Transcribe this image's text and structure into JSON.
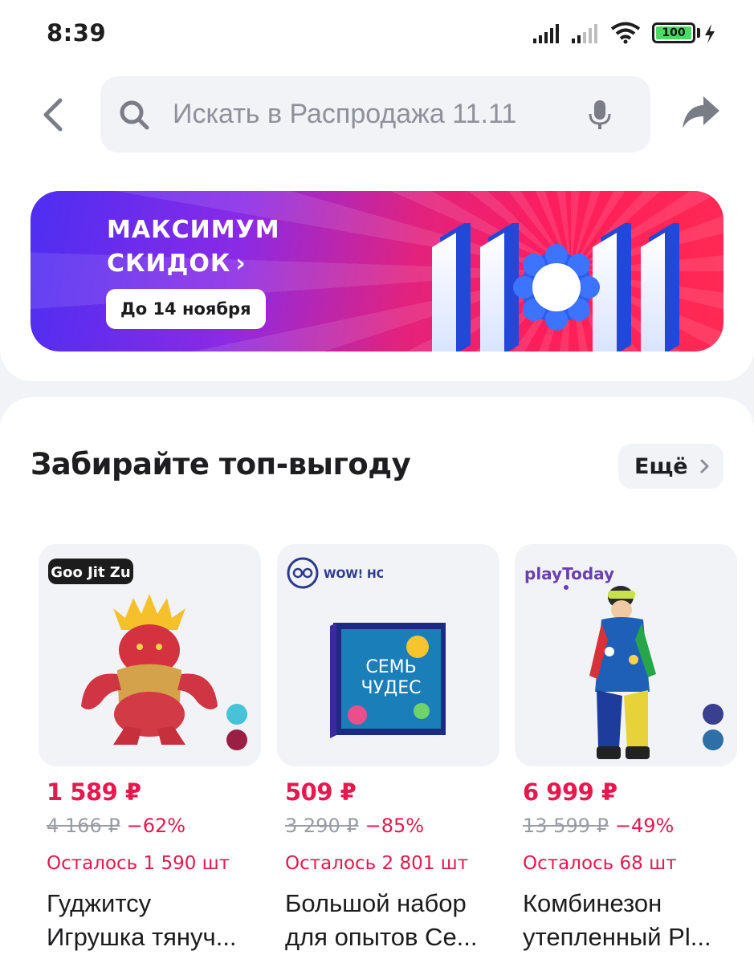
{
  "status_bar": {
    "time": "8:39",
    "battery": "100"
  },
  "search": {
    "placeholder": "Искать в Распродажа 11.11"
  },
  "banner": {
    "title_line1": "МАКСИМУМ",
    "title_line2": "СКИДОК",
    "pill": "До 14 ноября",
    "big_text": "11.11"
  },
  "section": {
    "title": "Забирайте топ-выгоду",
    "more": "Ещё"
  },
  "products": [
    {
      "brand": "Goo Jit Zu",
      "price": "1 589 ₽",
      "old_price": "4 166 ₽",
      "discount": "−62%",
      "stock": "Осталось 1 590 шт",
      "name_line1": "Гуджитсу",
      "name_line2": "Игрушка тянуч...",
      "swatches": [
        "#47c2d9",
        "#9a1f45"
      ]
    },
    {
      "brand": "WOW! HOW?",
      "price": "509 ₽",
      "old_price": "3 290 ₽",
      "discount": "−85%",
      "stock": "Осталось 2 801 шт",
      "name_line1": "Большой набор",
      "name_line2": "для опытов Се...",
      "box_title1": "СЕМЬ",
      "box_title2": "ЧУДЕС",
      "swatches": []
    },
    {
      "brand": "playToday",
      "price": "6 999 ₽",
      "old_price": "13 599 ₽",
      "discount": "−49%",
      "stock": "Осталось 68 шт",
      "name_line1": "Комбинезон",
      "name_line2": "утепленный Pl...",
      "swatches": [
        "#3a3f8f",
        "#2f6fa8"
      ]
    }
  ],
  "colors": {
    "accent": "#e6184d",
    "muted": "#9a9ca5",
    "bg": "#f2f3f7"
  }
}
